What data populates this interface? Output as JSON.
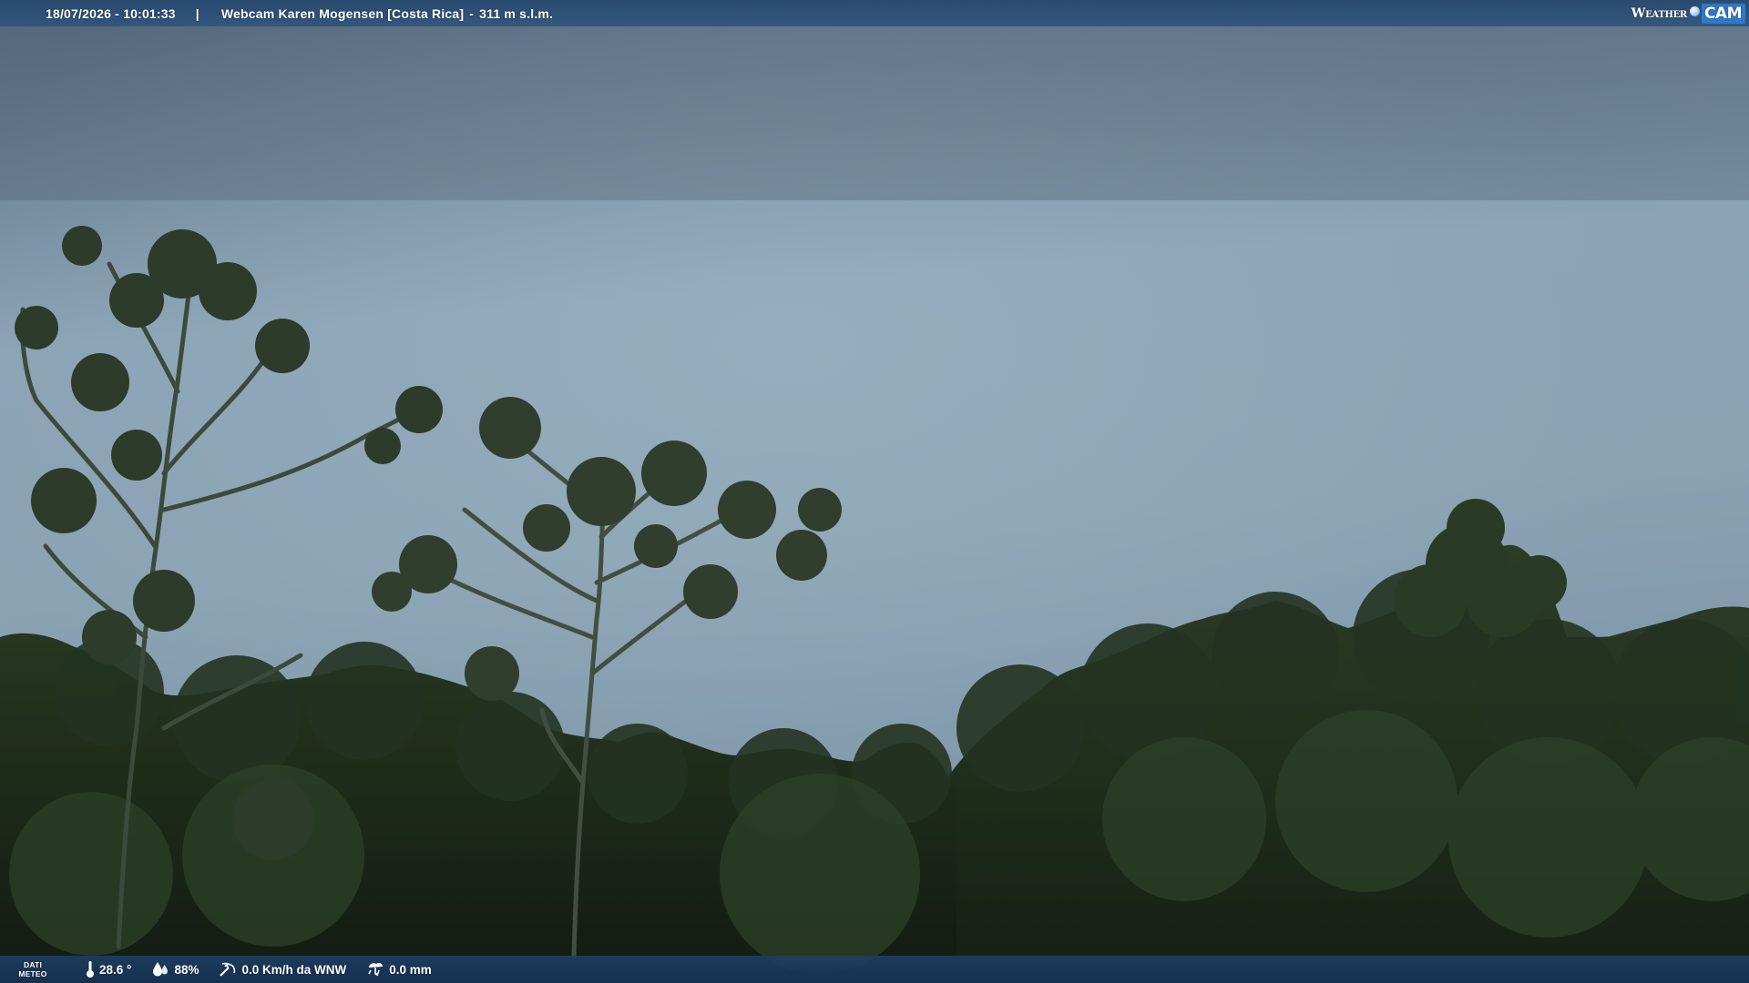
{
  "header": {
    "datetime": "18/07/2026 - 10:01:33",
    "separator": "|",
    "webcam_name": "Webcam Karen Mogensen [Costa Rica]",
    "title_separator": "-",
    "altitude": "311 m s.l.m.",
    "logo": {
      "word_left": "Weather",
      "word_right": "CAM",
      "accent_color": "#2f79c9"
    }
  },
  "weather_bar": {
    "label_line1": "DATI",
    "label_line2": "METEO",
    "temperature": "28.6 °",
    "temperature_icon": "thermometer-icon",
    "humidity": "88%",
    "humidity_icon": "humidity-drops-icon",
    "wind": "0.0 Km/h da WNW",
    "wind_icon": "wind-arrow-icon",
    "rain": "0.0 mm",
    "rain_icon": "rain-gauge-icon",
    "bar_color": "#1e3e64"
  },
  "scene": {
    "sky_top_color": "#566a7d",
    "sky_mid_color": "#8ea6b7",
    "forest_dark_color": "#172116",
    "foliage_color": "#1f2e1c"
  }
}
